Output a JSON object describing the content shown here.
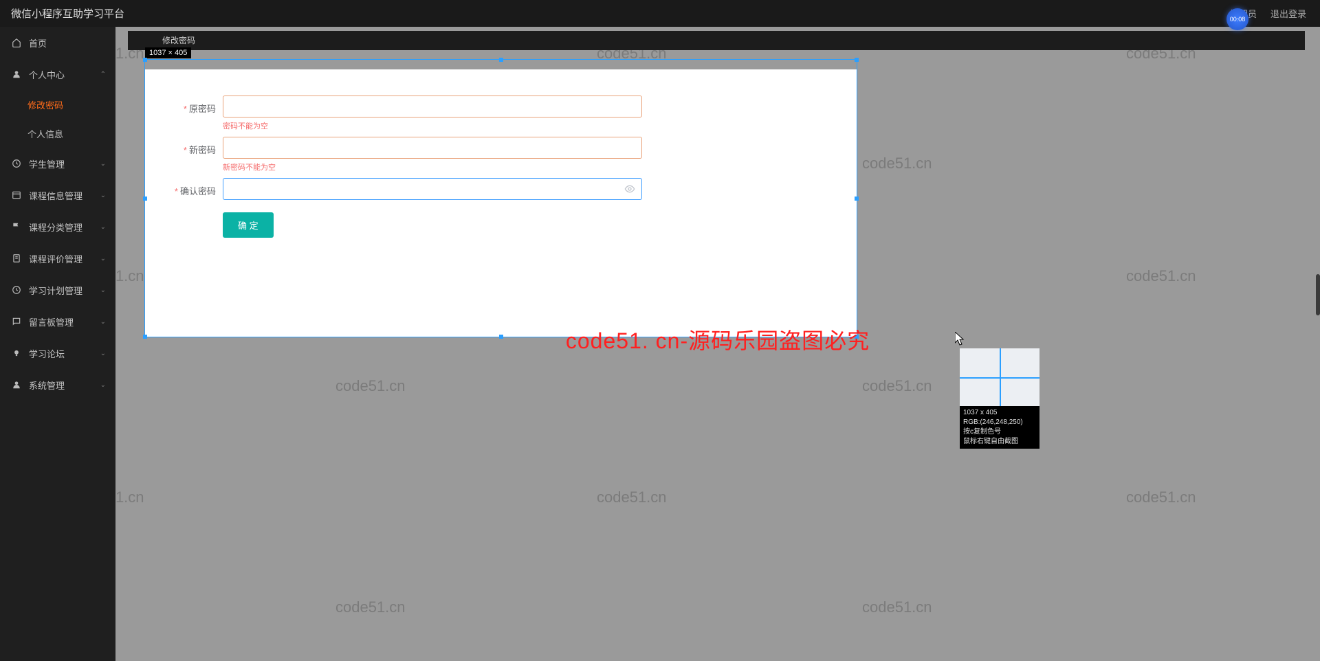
{
  "topbar": {
    "title": "微信小程序互助学习平台",
    "admin_link": "管理员",
    "logout_link": "退出登录"
  },
  "timer": {
    "value": "00:08"
  },
  "sidebar": {
    "items": [
      {
        "icon": "home-icon",
        "label": "首页",
        "expandable": false
      },
      {
        "icon": "user-icon",
        "label": "个人中心",
        "expandable": true,
        "expanded": true,
        "children": [
          {
            "label": "修改密码",
            "active": true
          },
          {
            "label": "个人信息",
            "active": false
          }
        ]
      },
      {
        "icon": "clock-icon",
        "label": "学生管理",
        "expandable": true
      },
      {
        "icon": "list-icon",
        "label": "课程信息管理",
        "expandable": true
      },
      {
        "icon": "flag-icon",
        "label": "课程分类管理",
        "expandable": true
      },
      {
        "icon": "doc-icon",
        "label": "课程评价管理",
        "expandable": true
      },
      {
        "icon": "clock-icon",
        "label": "学习计划管理",
        "expandable": true
      },
      {
        "icon": "message-icon",
        "label": "留言板管理",
        "expandable": true
      },
      {
        "icon": "bulb-icon",
        "label": "学习论坛",
        "expandable": true
      },
      {
        "icon": "user-icon",
        "label": "系统管理",
        "expandable": true
      }
    ]
  },
  "tab": {
    "label": "修改密码"
  },
  "form": {
    "old_pwd": {
      "label": "原密码",
      "value": "",
      "error": "密码不能为空"
    },
    "new_pwd": {
      "label": "新密码",
      "value": "",
      "error": "新密码不能为空"
    },
    "confirm_pwd": {
      "label": "确认密码",
      "value": ""
    },
    "submit": "确 定"
  },
  "selection": {
    "label": "1037 × 405"
  },
  "zoom_panel": {
    "line1": "1037 x 405",
    "line2": "RGB:(246,248,250)",
    "line3": "按c复制色号",
    "line4": "鼠标右键自由截图"
  },
  "center_watermark": "code51. cn-源码乐园盗图必究",
  "bg_watermark": "code51.cn"
}
